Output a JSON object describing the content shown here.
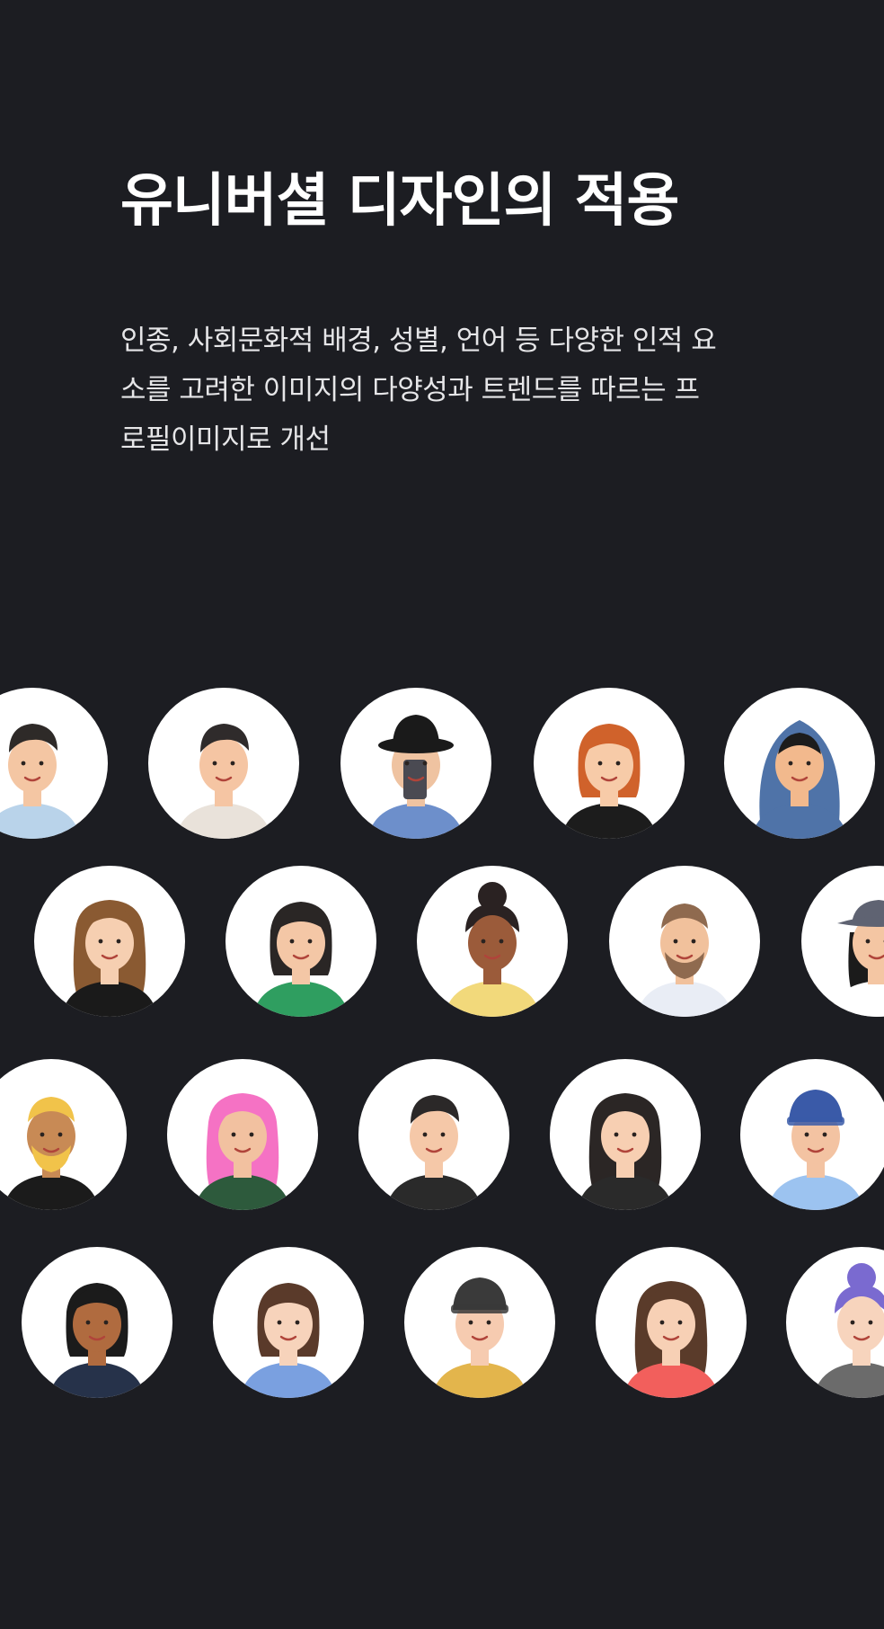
{
  "header": {
    "title": "유니버셜 디자인의 적용",
    "description_lines": [
      "인종, 사회문화적 배경, 성별, 언어 등 다양한 인적 요",
      "소를 고려한 이미지의 다양성과 트렌드를 따르는 프",
      "로필이미지로 개선"
    ]
  },
  "colors": {
    "background": "#1c1d22",
    "title_text": "#ffffff",
    "body_text": "#e6e6e8",
    "avatar_circle": "#ffffff"
  },
  "avatars": [
    {
      "name": "avatar-curly-hair-man",
      "skin": "#f4c6a3",
      "hair": "#2e2a28",
      "shirt": "#b9d3ea",
      "style": "short"
    },
    {
      "name": "avatar-short-hair-man",
      "skin": "#f5c5a3",
      "hair": "#2f2b2b",
      "shirt": "#e9e2da",
      "style": "short"
    },
    {
      "name": "avatar-bucket-hat-phone",
      "skin": "#efc3a1",
      "hair": "#1a1a1a",
      "shirt": "#6d8fcb",
      "style": "hat-black"
    },
    {
      "name": "avatar-red-bun-woman",
      "skin": "#f7cba8",
      "hair": "#d0622b",
      "shirt": "#1c1c1c",
      "style": "bob"
    },
    {
      "name": "avatar-blue-hoodie",
      "skin": "#f2b98d",
      "hair": "#1c1c1c",
      "shirt": "#4f73a8",
      "style": "hood"
    },
    {
      "name": "avatar-glasses-wavy-woman",
      "skin": "#f6cfb1",
      "hair": "#8a5a32",
      "shirt": "#1a1a1a",
      "style": "long"
    },
    {
      "name": "avatar-round-glasses",
      "skin": "#f4c7a6",
      "hair": "#2a2625",
      "shirt": "#2f9e60",
      "style": "bob"
    },
    {
      "name": "avatar-curly-bun-woman",
      "skin": "#9b5b3a",
      "hair": "#2a2222",
      "shirt": "#f2d97b",
      "style": "bun"
    },
    {
      "name": "avatar-bearded-man",
      "skin": "#f1c19c",
      "hair": "#8f6a4f",
      "shirt": "#e9edf5",
      "style": "beard"
    },
    {
      "name": "avatar-cap-woman",
      "skin": "#f4c6a3",
      "hair": "#1b1b1b",
      "shirt": "#ffffff",
      "style": "cap"
    },
    {
      "name": "avatar-blonde-bearded-man",
      "skin": "#c88a55",
      "hair": "#f1c34a",
      "shirt": "#1b1b1b",
      "style": "beard"
    },
    {
      "name": "avatar-pink-hair-woman",
      "skin": "#f2c1a0",
      "hair": "#f572c4",
      "shirt": "#2d5a3c",
      "style": "long"
    },
    {
      "name": "avatar-suit-man",
      "skin": "#f5c8a8",
      "hair": "#2b2828",
      "shirt": "#2a2a2a",
      "style": "short"
    },
    {
      "name": "avatar-suit-woman",
      "skin": "#f7cfb2",
      "hair": "#2b2625",
      "shirt": "#2a2a2a",
      "style": "long"
    },
    {
      "name": "avatar-beanie-man",
      "skin": "#f3c3a2",
      "hair": "#3a5aa8",
      "shirt": "#9cc3f0",
      "style": "beanie"
    },
    {
      "name": "avatar-winking-woman",
      "skin": "#b06b3f",
      "hair": "#1b1b1b",
      "shirt": "#26324a",
      "style": "bob"
    },
    {
      "name": "avatar-bob-hair-woman",
      "skin": "#f7d3bb",
      "hair": "#5a3a2a",
      "shirt": "#7aa0e0",
      "style": "bob"
    },
    {
      "name": "avatar-knit-cap-man",
      "skin": "#f6cbb0",
      "hair": "#3a3a3a",
      "shirt": "#e3b54c",
      "style": "beanie"
    },
    {
      "name": "avatar-headband-woman",
      "skin": "#f7d0b5",
      "hair": "#5a3b2a",
      "shirt": "#f25f5c",
      "style": "long"
    },
    {
      "name": "avatar-headset-woman",
      "skin": "#f7d4bd",
      "hair": "#7a6ad0",
      "shirt": "#6b6b6b",
      "style": "bun"
    }
  ]
}
